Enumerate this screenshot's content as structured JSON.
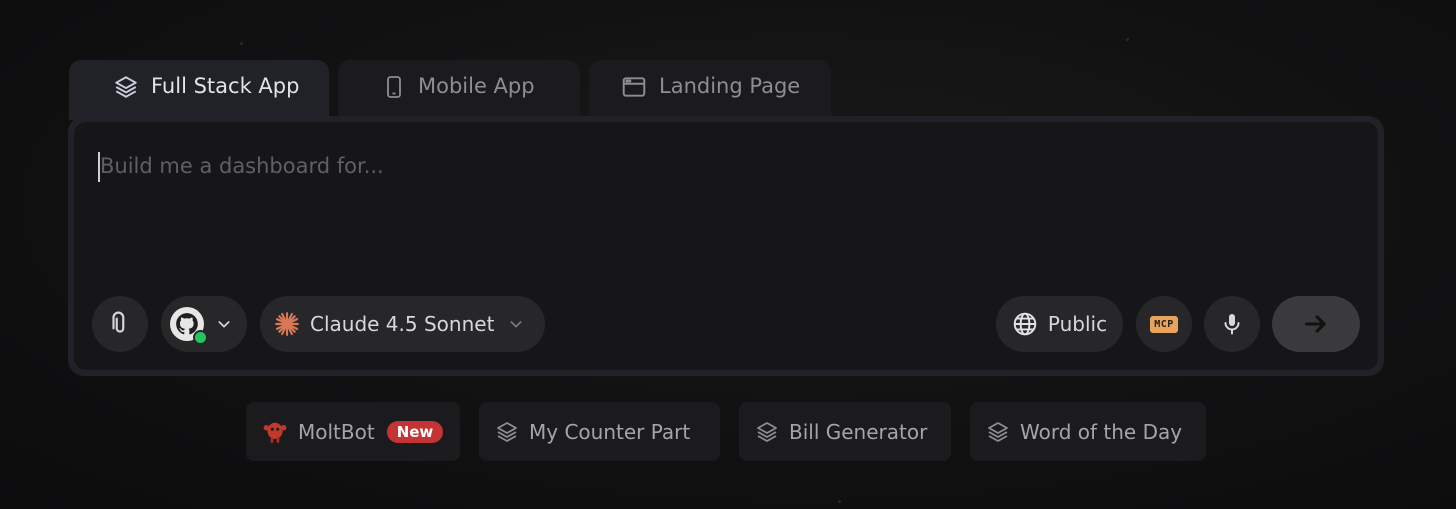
{
  "tabs": [
    {
      "label": "Full Stack App",
      "icon": "layers-icon",
      "active": true
    },
    {
      "label": "Mobile App",
      "icon": "phone-icon",
      "active": false
    },
    {
      "label": "Landing Page",
      "icon": "browser-window-icon",
      "active": false
    }
  ],
  "composer": {
    "placeholder": "Build me a dashboard for..."
  },
  "toolbar": {
    "attach_icon": "paperclip-icon",
    "github_icon": "github-icon",
    "github_status_color": "#22c55e",
    "model_label": "Claude 4.5 Sonnet",
    "model_icon": "claude-sparkle-icon",
    "model_icon_color": "#d97757",
    "visibility_label": "Public",
    "visibility_icon": "globe-icon",
    "mcp_label": "MCP",
    "mcp_color": "#e7a35a",
    "mic_icon": "microphone-icon",
    "send_icon": "arrow-right-icon"
  },
  "suggestions": [
    {
      "label": "MoltBot",
      "badge": "New",
      "icon": "moltbot-icon"
    },
    {
      "label": "My Counter Part",
      "icon": "layers-icon"
    },
    {
      "label": "Bill Generator",
      "icon": "layers-icon"
    },
    {
      "label": "Word of the Day",
      "icon": "layers-icon"
    }
  ],
  "colors": {
    "accent_new_badge": "#c53434",
    "panel": "#202228",
    "input_bg": "#161618"
  }
}
